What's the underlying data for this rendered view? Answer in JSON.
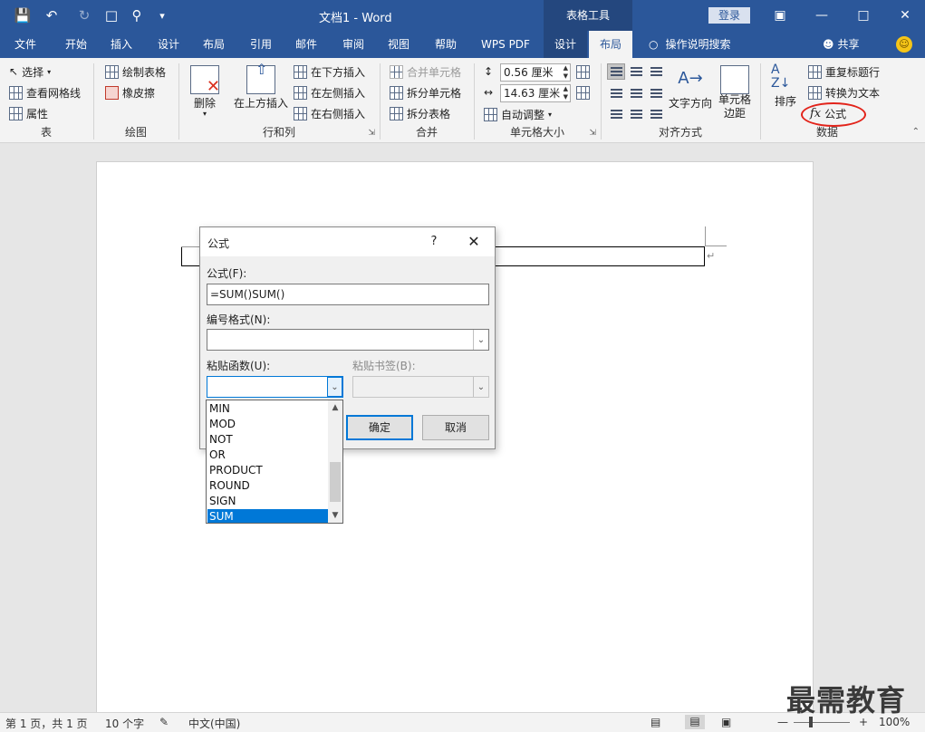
{
  "window": {
    "title": "文档1 - Word",
    "context_tab_label": "表格工具",
    "login_label": "登录"
  },
  "tabs": [
    "文件",
    "开始",
    "插入",
    "设计",
    "布局",
    "引用",
    "邮件",
    "审阅",
    "视图",
    "帮助",
    "WPS PDF",
    "设计",
    "布局"
  ],
  "help_search": "操作说明搜索",
  "share_label": "共享",
  "ribbon": {
    "table_group": {
      "label": "表",
      "select": "选择",
      "view_gridlines": "查看网格线",
      "properties": "属性"
    },
    "draw_group": {
      "label": "绘图",
      "draw_table": "绘制表格",
      "eraser": "橡皮擦"
    },
    "rows_cols_group": {
      "label": "行和列",
      "delete": "删除",
      "insert_above": "在上方插入",
      "insert_below": "在下方插入",
      "insert_left": "在左侧插入",
      "insert_right": "在右侧插入"
    },
    "merge_group": {
      "label": "合并",
      "merge_cells": "合并单元格",
      "split_cells": "拆分单元格",
      "split_table": "拆分表格"
    },
    "cell_size_group": {
      "label": "单元格大小",
      "height_value": "0.56 厘米",
      "width_value": "14.63 厘米",
      "autofit": "自动调整"
    },
    "alignment_group": {
      "label": "对齐方式",
      "text_direction": "文字方向",
      "cell_margins_line1": "单元格",
      "cell_margins_line2": "边距"
    },
    "data_group": {
      "label": "数据",
      "sort": "排序",
      "repeat_header": "重复标题行",
      "convert_to_text": "转换为文本",
      "formula": "公式"
    }
  },
  "dialog": {
    "title": "公式",
    "help": "?",
    "formula_label": "公式(F):",
    "formula_value": "=SUM()SUM()",
    "number_format_label": "编号格式(N):",
    "paste_function_label": "粘贴函数(U):",
    "paste_bookmark_label": "粘贴书签(B):",
    "ok": "确定",
    "cancel": "取消"
  },
  "function_list": {
    "items": [
      "MIN",
      "MOD",
      "NOT",
      "OR",
      "PRODUCT",
      "ROUND",
      "SIGN",
      "SUM"
    ],
    "selected": "SUM"
  },
  "status": {
    "page": "第 1 页，共 1 页",
    "words": "10 个字",
    "language": "中文(中国)",
    "zoom": "100%"
  },
  "watermark": "最需教育"
}
